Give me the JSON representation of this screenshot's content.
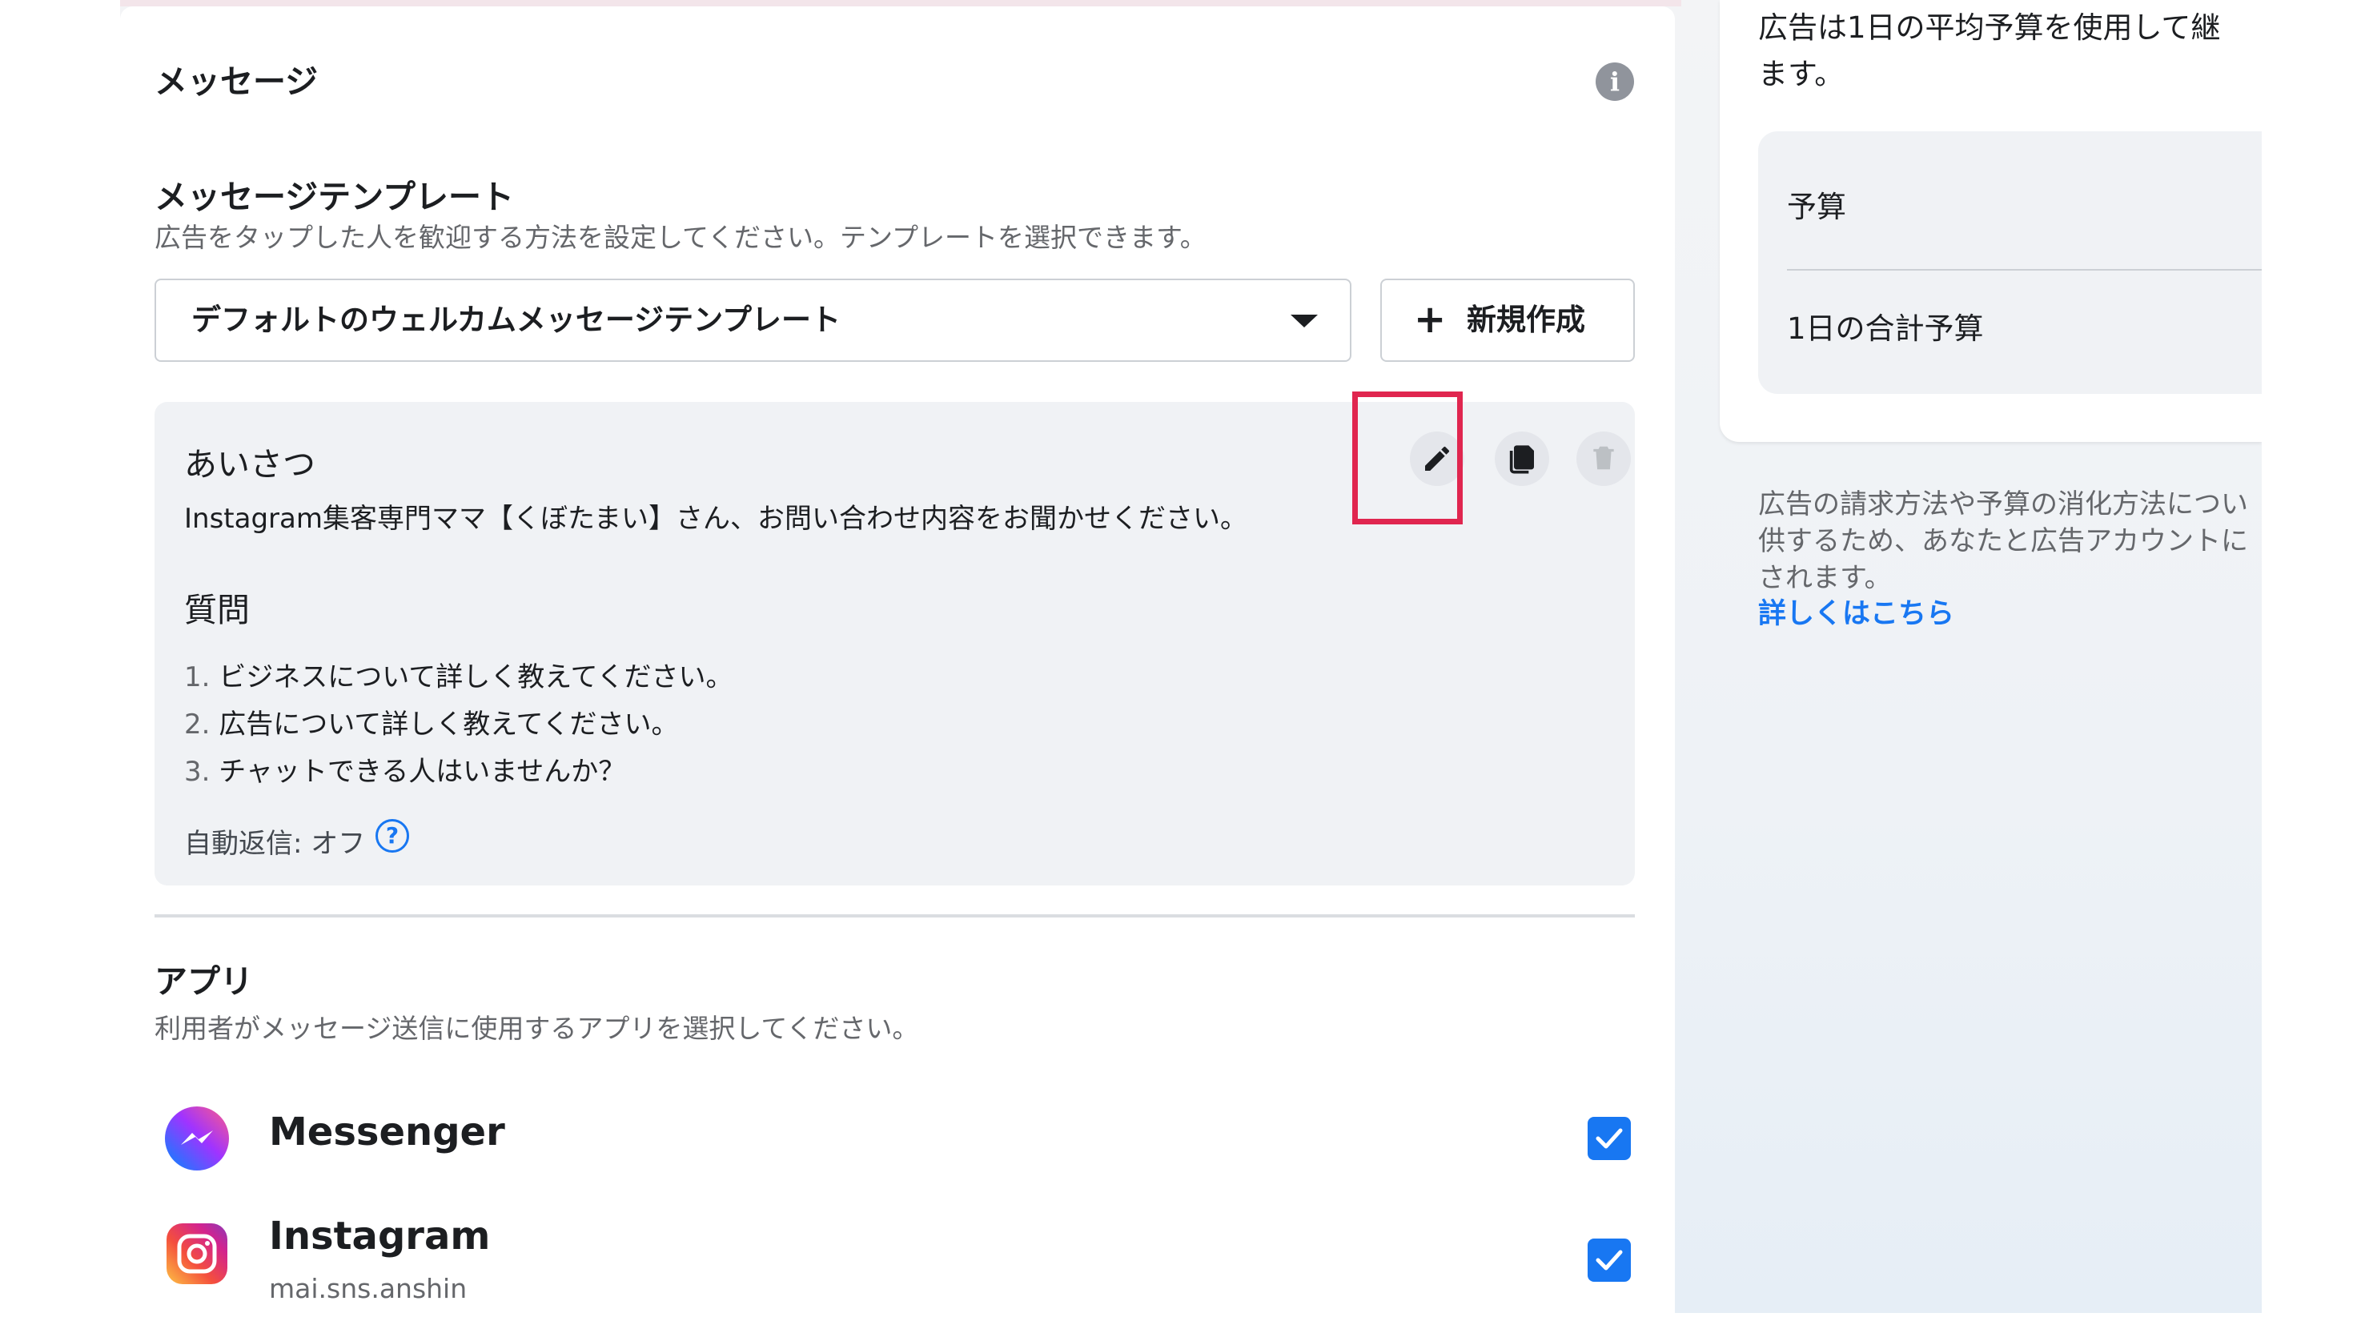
{
  "message_section": {
    "title": "メッセージ",
    "info_icon_glyph": "i"
  },
  "template_section": {
    "title": "メッセージテンプレート",
    "description": "広告をタップした人を歓迎する方法を設定してください。テンプレートを選択できます。",
    "selected_template": "デフォルトのウェルカムメッセージテンプレート",
    "new_button_icon": "+",
    "new_button_label": "新規作成"
  },
  "template_preview": {
    "greeting_heading": "あいさつ",
    "greeting_text": "Instagram集客専門ママ【くぼたまい】さん、お問い合わせ内容をお聞かせください。",
    "questions_heading": "質問",
    "questions": [
      {
        "num": "1.",
        "text": "ビジネスについて詳しく教えてください。"
      },
      {
        "num": "2.",
        "text": "広告について詳しく教えてください。"
      },
      {
        "num": "3.",
        "text": "チャットできる人はいませんか？"
      }
    ],
    "auto_reply": "自動返信: オフ",
    "help_glyph": "?"
  },
  "apps_section": {
    "title": "アプリ",
    "description": "利用者がメッセージ送信に使用するアプリを選択してください。",
    "apps": [
      {
        "name": "Messenger",
        "sub": "",
        "checked": true
      },
      {
        "name": "Instagram",
        "sub": "mai.sns.anshin",
        "checked": true
      }
    ]
  },
  "right_panel": {
    "top_line1": "広告は1日の平均予算を使用して継",
    "top_line2": "ます。",
    "budget_label": "予算",
    "daily_total_label": "1日の合計予算",
    "info_line1": "広告の請求方法や予算の消化方法につい",
    "info_line2": "供するため、あなたと広告アカウントに",
    "info_line3": "されます。",
    "learn_more": "詳しくはこちら"
  },
  "colors": {
    "accent": "#1877f2",
    "highlight": "#e0264f",
    "muted_text": "#65676b"
  },
  "icons": [
    "info-icon",
    "chevron-down-icon",
    "plus-icon",
    "pencil-icon",
    "copy-icon",
    "trash-icon",
    "help-circle-icon",
    "messenger-icon",
    "instagram-icon",
    "checkbox-check-icon"
  ]
}
